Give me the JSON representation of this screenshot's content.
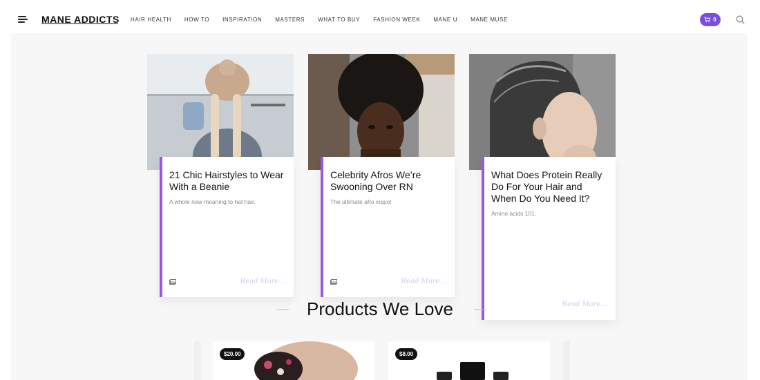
{
  "header": {
    "logo": "MANE ADDICTS",
    "nav": [
      "HAIR HEALTH",
      "HOW TO",
      "INSPIRATION",
      "MASTERS",
      "WHAT TO BUY",
      "FASHION WEEK",
      "MANE U",
      "MANE MUSE"
    ],
    "cart_count": "0"
  },
  "articles": [
    {
      "title": "21 Chic Hairstyles to Wear With a Beanie",
      "subtitle": "A whole new meaning to hat hair.",
      "read_more": "Read More..."
    },
    {
      "title": "Celebrity Afros We’re Swooning Over RN",
      "subtitle": "The ultimate afro inspo!",
      "read_more": "Read More..."
    },
    {
      "title": "What Does Protein Really Do For Your Hair and When Do You Need It?",
      "subtitle": "Amino acids 101.",
      "read_more": "Read More..."
    }
  ],
  "products_section": {
    "title": "Products We Love",
    "items": [
      {
        "price": "$20.00"
      },
      {
        "price": "$8.00"
      }
    ]
  },
  "colors": {
    "accent": "#9b59e0",
    "cart": "#7a4fe0"
  }
}
